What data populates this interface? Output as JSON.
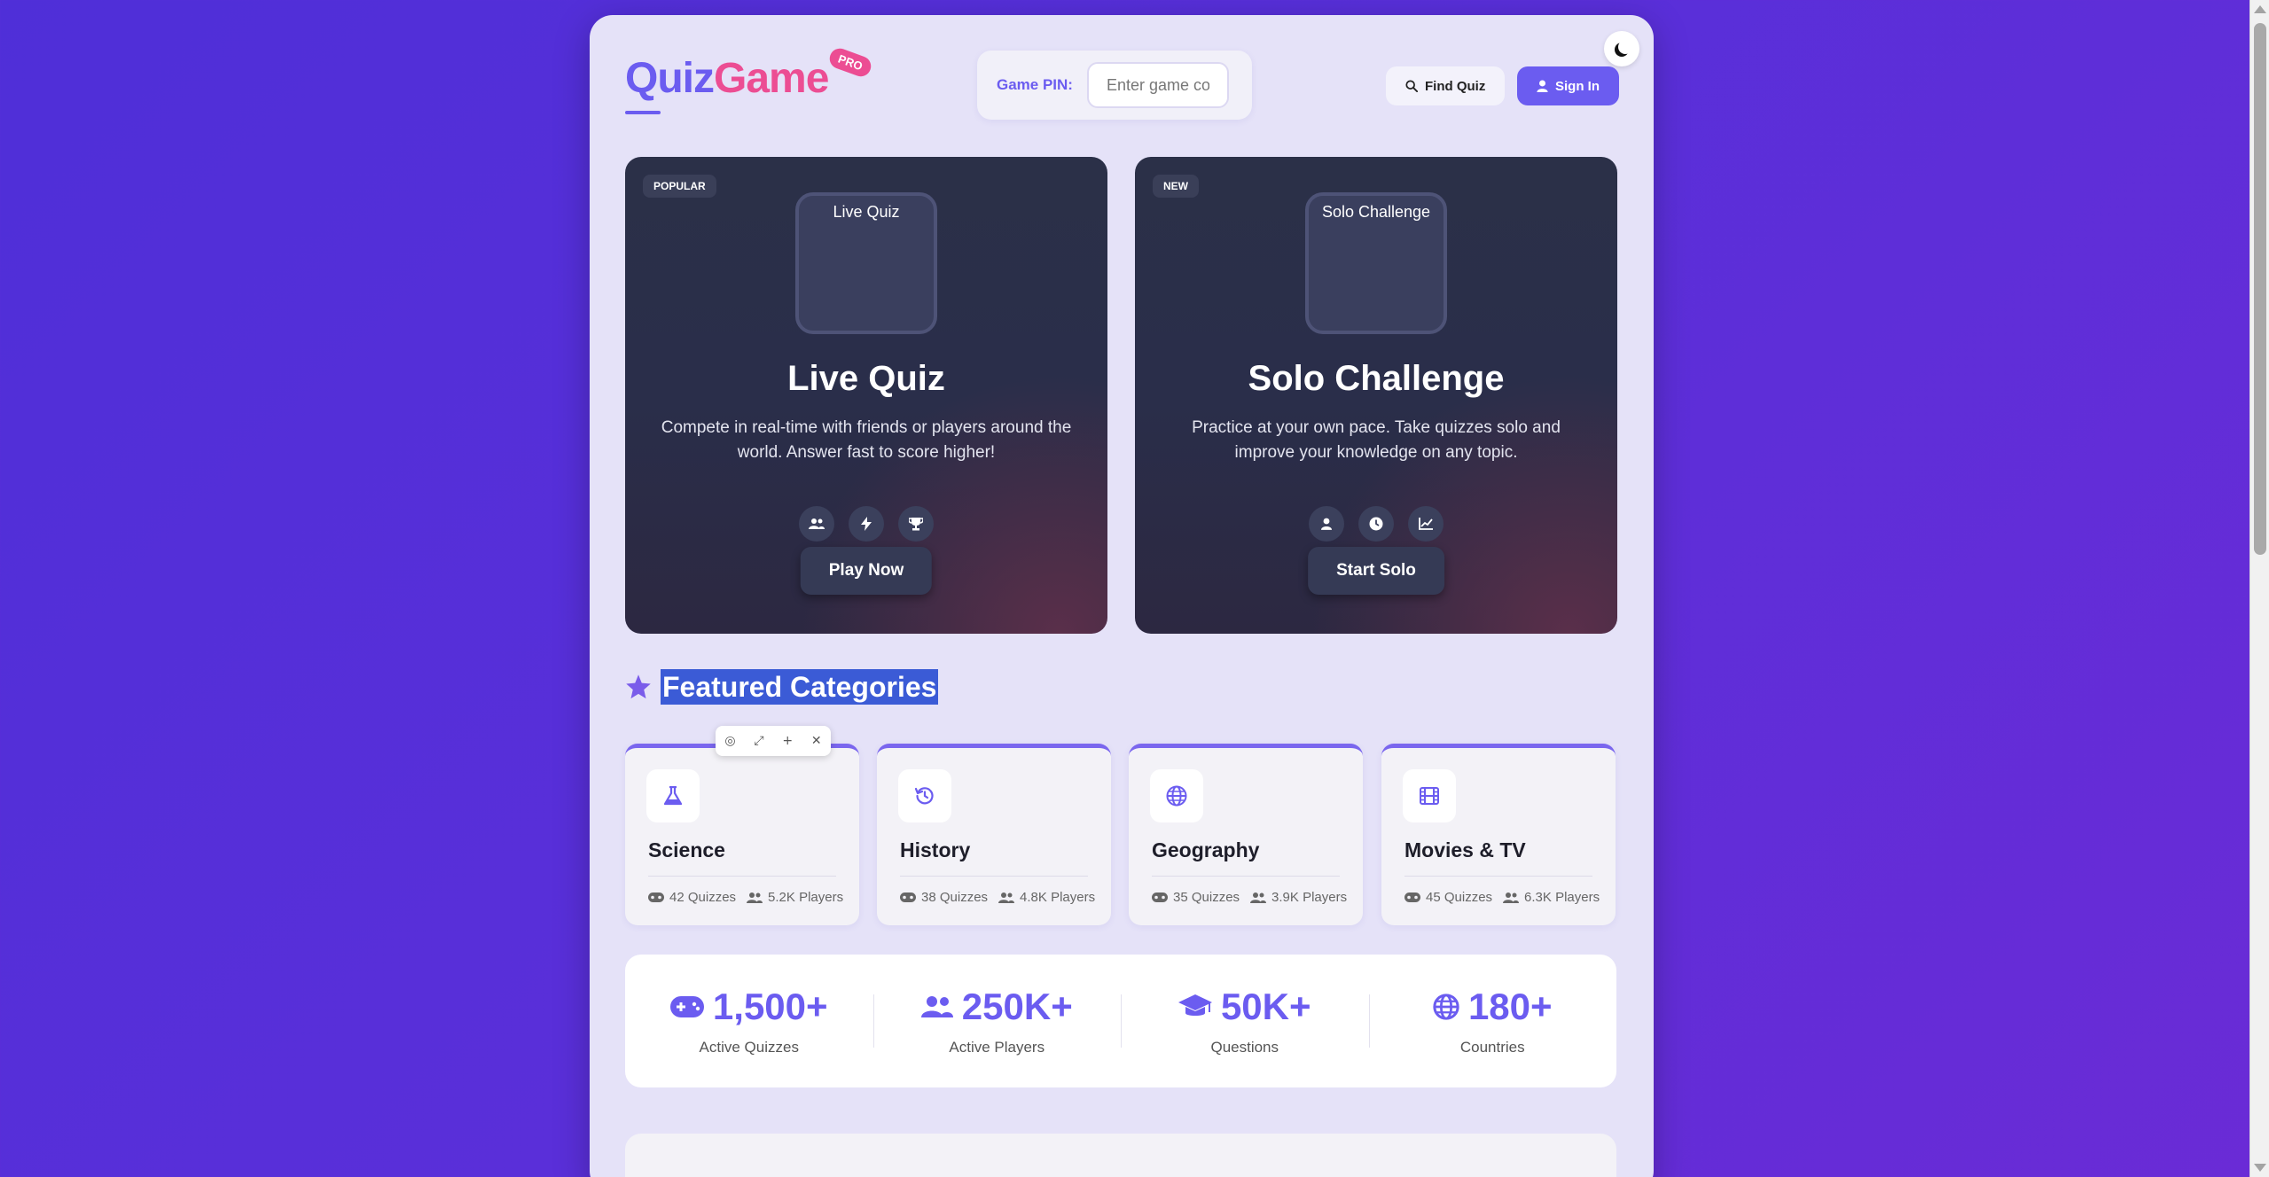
{
  "header": {
    "logo_part1": "Quiz",
    "logo_part2": "Game",
    "pro_badge": "PRO",
    "pin_label": "Game PIN:",
    "pin_placeholder": "Enter game code",
    "find_quiz": "Find Quiz",
    "sign_in": "Sign In"
  },
  "modes": [
    {
      "badge": "POPULAR",
      "image_alt": "Live Quiz",
      "title": "Live Quiz",
      "description": "Compete in real-time with friends or players around the world. Answer fast to score higher!",
      "icons": [
        "users-icon",
        "bolt-icon",
        "trophy-icon"
      ],
      "button": "Play Now"
    },
    {
      "badge": "NEW",
      "image_alt": "Solo Challenge",
      "title": "Solo Challenge",
      "description": "Practice at your own pace. Take quizzes solo and improve your knowledge on any topic.",
      "icons": [
        "user-icon",
        "clock-icon",
        "chart-line-icon"
      ],
      "button": "Start Solo"
    }
  ],
  "featured": {
    "title": "Featured Categories",
    "categories": [
      {
        "name": "Science",
        "icon": "flask-icon",
        "quizzes": "42 Quizzes",
        "players": "5.2K Players"
      },
      {
        "name": "History",
        "icon": "history-icon",
        "quizzes": "38 Quizzes",
        "players": "4.8K Players"
      },
      {
        "name": "Geography",
        "icon": "globe-icon",
        "quizzes": "35 Quizzes",
        "players": "3.9K Players"
      },
      {
        "name": "Movies & TV",
        "icon": "film-icon",
        "quizzes": "45 Quizzes",
        "players": "6.3K Players"
      }
    ]
  },
  "stats": [
    {
      "value": "1,500+",
      "label": "Active Quizzes",
      "icon": "gamepad-icon"
    },
    {
      "value": "250K+",
      "label": "Active Players",
      "icon": "users-icon"
    },
    {
      "value": "50K+",
      "label": "Questions",
      "icon": "graduation-cap-icon"
    },
    {
      "value": "180+",
      "label": "Countries",
      "icon": "globe-icon"
    }
  ],
  "colors": {
    "accent": "#6b5cf0",
    "pink": "#ec4d93",
    "background": "#5a2fd9",
    "card_dark": "#2b3048"
  }
}
